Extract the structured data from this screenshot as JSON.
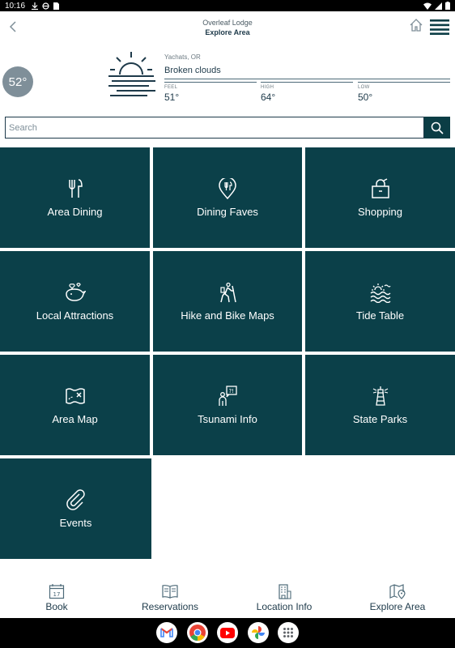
{
  "status_bar": {
    "time": "10:16"
  },
  "header": {
    "subtitle": "Overleaf Lodge",
    "title": "Explore Area"
  },
  "weather": {
    "temp": "52°",
    "location": "Yachats, OR",
    "conditions": "Broken clouds",
    "feel_label": "FEEL",
    "feel_value": "51°",
    "high_label": "HIGH",
    "high_value": "64°",
    "low_label": "LOW",
    "low_value": "50°"
  },
  "search": {
    "placeholder": "Search",
    "value": ""
  },
  "tiles": [
    {
      "label": "Area Dining",
      "icon": "fork-knife-icon"
    },
    {
      "label": "Dining Faves",
      "icon": "dining-pin-icon"
    },
    {
      "label": "Shopping",
      "icon": "shopping-bag-icon"
    },
    {
      "label": "Local Attractions",
      "icon": "whale-icon"
    },
    {
      "label": "Hike and Bike Maps",
      "icon": "hiker-icon"
    },
    {
      "label": "Tide Table",
      "icon": "waves-icon"
    },
    {
      "label": "Area Map",
      "icon": "treasure-map-icon"
    },
    {
      "label": "Tsunami Info",
      "icon": "person-alert-icon"
    },
    {
      "label": "State Parks",
      "icon": "lighthouse-icon"
    },
    {
      "label": "Events",
      "icon": "paperclip-icon"
    }
  ],
  "bottom_nav": [
    {
      "label": "Book",
      "icon": "calendar-icon",
      "day": "17"
    },
    {
      "label": "Reservations",
      "icon": "book-icon"
    },
    {
      "label": "Location Info",
      "icon": "building-icon"
    },
    {
      "label": "Explore Area",
      "icon": "map-pin-icon"
    }
  ],
  "dock": [
    "gmail-icon",
    "chrome-icon",
    "youtube-icon",
    "photos-icon",
    "apps-icon"
  ],
  "colors": {
    "tile": "#0b4049",
    "accent": "#1e3a4a",
    "temp_circle": "#7f8f99"
  }
}
